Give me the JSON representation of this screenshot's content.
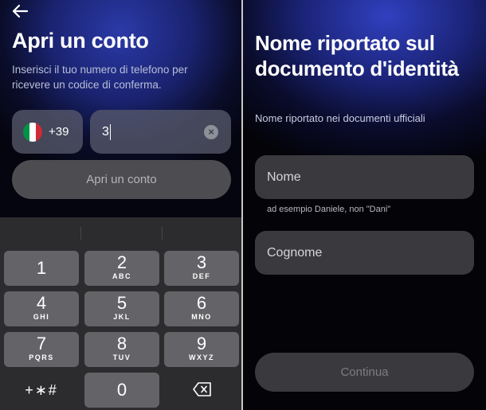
{
  "left_screen": {
    "title": "Apri un conto",
    "subtitle": "Inserisci il tuo numero di telefono per ricevere un codice di conferma.",
    "country": {
      "flag": "italy-flag",
      "prefix": "+39"
    },
    "phone_value": "3",
    "submit_label": "Apri un conto"
  },
  "keyboard": {
    "keys": [
      {
        "num": "1",
        "letters": ""
      },
      {
        "num": "2",
        "letters": "ABC"
      },
      {
        "num": "3",
        "letters": "DEF"
      },
      {
        "num": "4",
        "letters": "GHI"
      },
      {
        "num": "5",
        "letters": "JKL"
      },
      {
        "num": "6",
        "letters": "MNO"
      },
      {
        "num": "7",
        "letters": "PQRS"
      },
      {
        "num": "8",
        "letters": "TUV"
      },
      {
        "num": "9",
        "letters": "WXYZ"
      }
    ],
    "symbols_label": "+∗#",
    "zero": "0"
  },
  "right_screen": {
    "title": "Nome riportato sul documento d'identità",
    "subtitle": "Nome riportato nei documenti ufficiali",
    "first_name_placeholder": "Nome",
    "first_name_hint": "ad esempio Daniele, non \"Dani\"",
    "last_name_placeholder": "Cognome",
    "submit_label": "Continua"
  },
  "colors": {
    "accent_gradient": "#2b3aa8",
    "flag_green": "#009246",
    "flag_white": "#ffffff",
    "flag_red": "#ce2b37"
  }
}
